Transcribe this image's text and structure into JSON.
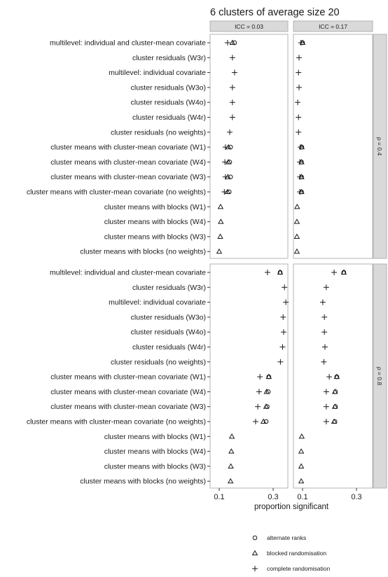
{
  "chart_data": {
    "type": "scatter",
    "title": "6 clusters of average size 20",
    "xlabel": "proportion significant",
    "ylabel": "",
    "xlim": [
      0.066,
      0.36
    ],
    "xticks": [
      0.1,
      0.3
    ],
    "xtick_labels": [
      "0.1",
      "0.3"
    ],
    "grid": false,
    "legend_position": "bottom",
    "column_facets": [
      "ICC = 0.03",
      "ICC = 0.17"
    ],
    "row_facets": [
      "ρ = 0.4",
      "ρ = 0.8"
    ],
    "categories": [
      "multilevel: individual and cluster-mean covariate",
      "cluster residuals (W3r)",
      "multilevel: individual covariate",
      "cluster residuals (W3o)",
      "cluster residuals (W4o)",
      "cluster residuals (W4r)",
      "cluster residuals (no weights)",
      "cluster means with cluster-mean covariate (W1)",
      "cluster means with cluster-mean covariate (W4)",
      "cluster means with cluster-mean covariate (W3)",
      "cluster means with cluster-mean covariate (no weights)",
      "cluster means with blocks (W1)",
      "cluster means with blocks (W4)",
      "cluster means with blocks (W3)",
      "cluster means with blocks (no weights)"
    ],
    "legend": [
      {
        "key": "alternate",
        "label": "alternate ranks",
        "shape": "circle"
      },
      {
        "key": "blocked",
        "label": "blocked randomisation",
        "shape": "triangle"
      },
      {
        "key": "complete",
        "label": "complete randomisation",
        "shape": "plus"
      }
    ],
    "panels": [
      {
        "row": 0,
        "col": 0,
        "complete": [
          0.131,
          0.149,
          0.157,
          0.149,
          0.149,
          0.149,
          0.139,
          0.123,
          0.121,
          0.123,
          0.119,
          null,
          null,
          null,
          null
        ],
        "blocked": [
          0.149,
          null,
          null,
          null,
          null,
          null,
          null,
          0.134,
          0.134,
          0.132,
          0.131,
          0.105,
          0.106,
          0.104,
          0.1
        ],
        "alternate": [
          0.157,
          null,
          null,
          null,
          null,
          null,
          null,
          0.142,
          0.139,
          0.142,
          0.137,
          null,
          null,
          null,
          null
        ]
      },
      {
        "row": 0,
        "col": 1,
        "complete": [
          0.094,
          0.087,
          0.085,
          0.087,
          0.082,
          0.085,
          0.085,
          0.092,
          0.09,
          0.09,
          0.09,
          null,
          null,
          null,
          null
        ],
        "blocked": [
          0.1,
          null,
          null,
          null,
          null,
          null,
          null,
          0.097,
          0.096,
          0.096,
          0.096,
          0.08,
          0.079,
          0.079,
          0.079
        ],
        "alternate": [
          0.1,
          null,
          null,
          null,
          null,
          null,
          null,
          0.097,
          0.096,
          0.096,
          0.096,
          null,
          null,
          null,
          null
        ]
      },
      {
        "row": 1,
        "col": 0,
        "complete": [
          0.279,
          0.342,
          0.347,
          0.337,
          0.339,
          0.335,
          0.327,
          0.251,
          0.248,
          0.243,
          0.235,
          null,
          null,
          null,
          null
        ],
        "blocked": [
          0.326,
          null,
          null,
          null,
          null,
          null,
          null,
          0.284,
          0.276,
          0.274,
          0.264,
          0.147,
          0.145,
          0.143,
          0.142
        ],
        "alternate": [
          0.326,
          null,
          null,
          null,
          null,
          null,
          null,
          0.284,
          0.282,
          0.278,
          0.274,
          null,
          null,
          null,
          null
        ]
      },
      {
        "row": 1,
        "col": 1,
        "complete": [
          0.217,
          0.188,
          0.175,
          0.181,
          0.181,
          0.183,
          0.179,
          0.199,
          0.188,
          0.188,
          0.188,
          null,
          null,
          null,
          null
        ],
        "blocked": [
          0.253,
          null,
          null,
          null,
          null,
          null,
          null,
          0.227,
          0.22,
          0.22,
          0.217,
          0.097,
          0.095,
          0.095,
          0.095
        ],
        "alternate": [
          0.253,
          null,
          null,
          null,
          null,
          null,
          null,
          0.227,
          0.222,
          0.222,
          0.22,
          null,
          null,
          null,
          null
        ]
      }
    ]
  }
}
